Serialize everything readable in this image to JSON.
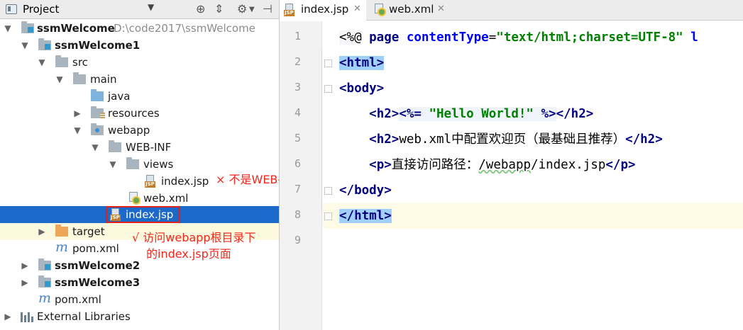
{
  "project_panel": {
    "title": "Project",
    "tree": [
      {
        "label": "ssmWelcome",
        "path": "D:\\code2017\\ssmWelcome"
      },
      {
        "label": "ssmWelcome1"
      },
      {
        "label": "src"
      },
      {
        "label": "main"
      },
      {
        "label": "java"
      },
      {
        "label": "resources"
      },
      {
        "label": "webapp"
      },
      {
        "label": "WEB-INF"
      },
      {
        "label": "views"
      },
      {
        "label": "index.jsp"
      },
      {
        "label": "web.xml"
      },
      {
        "label": "index.jsp"
      },
      {
        "label": "target"
      },
      {
        "label": "pom.xml"
      },
      {
        "label": "ssmWelcome2"
      },
      {
        "label": "ssmWelcome3"
      },
      {
        "label": "pom.xml"
      },
      {
        "label": "External Libraries"
      }
    ],
    "annotations": {
      "wrong": "× 不是WEB-INF/views/index.jsp的页面",
      "right_line1": "√ 访问webapp根目录下",
      "right_line2": "的index.jsp页面"
    }
  },
  "editor": {
    "tabs": [
      {
        "label": "index.jsp"
      },
      {
        "label": "web.xml"
      }
    ],
    "line_numbers": [
      "1",
      "2",
      "3",
      "4",
      "5",
      "6",
      "7",
      "8",
      "9"
    ],
    "code": {
      "l1_open": "<%@",
      "l1_page": " page ",
      "l1_attr": "contentType",
      "l1_eq": "=",
      "l1_val": "\"text/html;charset=UTF-8\"",
      "l1_rest": " l",
      "l2": "<html>",
      "l3": "<body>",
      "l4_h2open": "<h2>",
      "l4_expr_open": "<%= ",
      "l4_str": "\"Hello World!\"",
      "l4_expr_close": " %>",
      "l4_h2close": "</h2>",
      "l5_h2open": "<h2>",
      "l5_text": "web.xml中配置欢迎页（最基础且推荐）",
      "l5_h2close": "</h2>",
      "l6_popen": "<p>",
      "l6_text_a": "直接访问路径：",
      "l6_text_b": "/webapp",
      "l6_text_c": "/index.jsp",
      "l6_pclose": "</p>",
      "l7": "</body>",
      "l8": "</html>"
    }
  }
}
